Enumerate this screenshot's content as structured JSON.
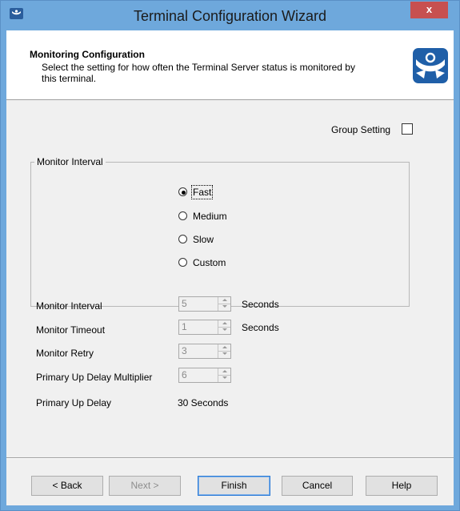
{
  "window": {
    "title": "Terminal Configuration Wizard",
    "close_label": "x"
  },
  "header": {
    "title": "Monitoring Configuration",
    "description": "Select the setting for how often the Terminal Server status is monitored by this terminal."
  },
  "group_setting": {
    "label": "Group Setting",
    "checked": false
  },
  "monitor_interval_group": {
    "legend": "Monitor Interval",
    "options": [
      "Fast",
      "Medium",
      "Slow",
      "Custom"
    ],
    "selected": "Fast"
  },
  "fields": {
    "monitor_interval": {
      "label": "Monitor Interval",
      "value": "5",
      "unit": "Seconds"
    },
    "monitor_timeout": {
      "label": "Monitor Timeout",
      "value": "1",
      "unit": "Seconds"
    },
    "monitor_retry": {
      "label": "Monitor Retry",
      "value": "3"
    },
    "primary_up_delay_multiplier": {
      "label": "Primary Up Delay Multiplier",
      "value": "6"
    },
    "primary_up_delay": {
      "label": "Primary Up Delay",
      "value": "30 Seconds"
    }
  },
  "buttons": {
    "back": "< Back",
    "next": "Next >",
    "finish": "Finish",
    "cancel": "Cancel",
    "help": "Help"
  },
  "colors": {
    "title_bar": "#6ea8dc",
    "close_button": "#c75050",
    "dialog_background": "#f0f0f0",
    "logo_blue": "#1f5fa8"
  },
  "icons": {
    "app": "wizard-app-icon",
    "logo": "thinmanager-logo-icon",
    "close": "close-icon"
  }
}
